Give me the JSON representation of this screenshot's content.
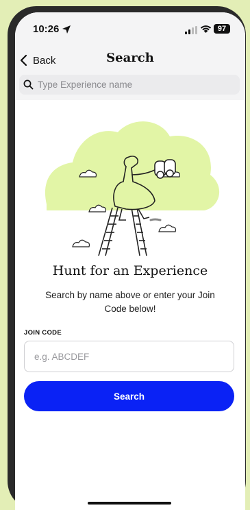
{
  "status_bar": {
    "time": "10:26",
    "battery": "97",
    "icons": [
      "location-arrow-icon",
      "signal-icon",
      "wifi-icon",
      "battery-icon"
    ]
  },
  "nav": {
    "back_label": "Back",
    "title": "Search"
  },
  "search": {
    "placeholder": "Type Experience name",
    "value": ""
  },
  "main": {
    "heading": "Hunt for an Experience",
    "subtext": "Search by name above or enter your Join Code below!"
  },
  "join": {
    "label": "JOIN CODE",
    "placeholder": "e.g. ABCDEF",
    "value": ""
  },
  "button": {
    "label": "Search"
  },
  "colors": {
    "accent": "#0a22f5",
    "blob": "#e2f5a6",
    "frame": "#e3eeb6"
  }
}
